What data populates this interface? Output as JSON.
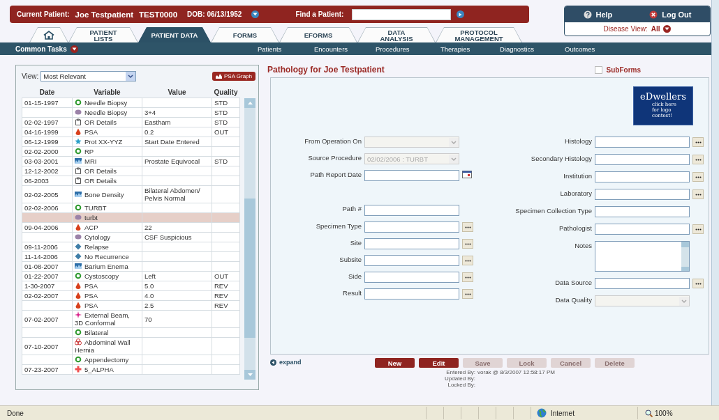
{
  "header": {
    "patient_label": "Current Patient:",
    "patient_name": "Joe Testpatient",
    "patient_id": "TEST0000",
    "dob": "DOB: 06/13/1952",
    "find_label": "Find a Patient:"
  },
  "user_box": {
    "help": "Help",
    "logout": "Log Out",
    "disease_view_label": "Disease View:",
    "disease_view_value": "All"
  },
  "tabs": [
    {
      "kind": "home",
      "selected": false
    },
    {
      "kind": "text",
      "label": "PATIENT\nLISTS",
      "selected": false
    },
    {
      "kind": "text",
      "label": "PATIENT DATA",
      "selected": true
    },
    {
      "kind": "text",
      "label": "FORMS",
      "selected": false
    },
    {
      "kind": "text",
      "label": "EFORMS",
      "selected": false
    },
    {
      "kind": "text",
      "label": "DATA\nANALYSIS",
      "selected": false
    },
    {
      "kind": "text",
      "label": "PROTOCOL\nMANAGEMENT",
      "selected": false
    }
  ],
  "subnav": {
    "common_tasks": "Common Tasks",
    "links": [
      "Patients",
      "Encounters",
      "Procedures",
      "Therapies",
      "Diagnostics",
      "Outcomes"
    ]
  },
  "left_panel": {
    "view_label": "View:",
    "view_value": "Most Relevant",
    "graph_button": "PSA Graph"
  },
  "table": {
    "columns": [
      "Date",
      "Variable",
      "Value",
      "Quality"
    ],
    "rows": [
      {
        "date": "01-15-1997",
        "kind": "ring",
        "variable": "Needle Biopsy",
        "quality": "STD",
        "selected": false
      },
      {
        "kind": "blob",
        "variable": "Needle Biopsy",
        "value": "3+4",
        "quality": "STD",
        "selected": false
      },
      {
        "date": "02-02-1997",
        "kind": "clipboard",
        "variable": "OR Details",
        "value": "Eastham",
        "quality": "STD",
        "selected": false
      },
      {
        "date": "04-16-1999",
        "kind": "drop",
        "variable": "PSA",
        "value": "0.2",
        "quality": "OUT",
        "selected": false
      },
      {
        "date": "06-12-1999",
        "kind": "star",
        "variable": "Prot XX-YYZ",
        "value": "Start Date Entered",
        "selected": false
      },
      {
        "date": "02-02-2000",
        "kind": "ring",
        "variable": "RP",
        "selected": false
      },
      {
        "date": "03-03-2001",
        "kind": "scan",
        "variable": "MRI",
        "value": "Prostate Equivocal",
        "quality": "STD",
        "selected": false
      },
      {
        "date": "12-12-2002",
        "kind": "clipboard",
        "variable": "OR Details",
        "selected": false
      },
      {
        "date": "06-2003",
        "kind": "clipboard",
        "variable": "OR Details",
        "selected": false
      },
      {
        "date": "02-02-2005",
        "kind": "scan",
        "variable": "Bone Density",
        "value": "Bilateral Abdomen/ Pelvis Normal",
        "selected": false
      },
      {
        "date": "02-02-2006",
        "kind": "ring",
        "variable": "TURBT",
        "selected": false
      },
      {
        "kind": "blob",
        "variable": "turbt",
        "selected": true
      },
      {
        "date": "09-04-2006",
        "kind": "drop",
        "variable": "ACP",
        "value": "22",
        "selected": false
      },
      {
        "kind": "blob",
        "variable": "Cytology",
        "value": "CSF Suspicious",
        "selected": false
      },
      {
        "date": "09-11-2006",
        "kind": "diamond",
        "variable": "Relapse",
        "selected": false
      },
      {
        "date": "11-14-2006",
        "kind": "diamond",
        "variable": "No Recurrence",
        "selected": false
      },
      {
        "date": "01-08-2007",
        "kind": "scan",
        "variable": "Barium Enema",
        "selected": false
      },
      {
        "date": "01-22-2007",
        "kind": "ring",
        "variable": "Cystoscopy",
        "value": "Left",
        "quality": "OUT",
        "selected": false
      },
      {
        "date": "1-30-2007",
        "kind": "drop",
        "variable": "PSA",
        "value": "5.0",
        "quality": "REV",
        "selected": false
      },
      {
        "date": "02-02-2007",
        "kind": "drop",
        "variable": "PSA",
        "value": "4.0",
        "quality": "REV",
        "selected": false
      },
      {
        "kind": "drop",
        "variable": "PSA",
        "value": "2.5",
        "quality": "REV",
        "selected": false
      },
      {
        "date": "07-02-2007",
        "kind": "spark",
        "variable": "External Beam, 3D Conformal",
        "value": "70",
        "selected": false
      },
      {
        "kind": "ring",
        "variable": "Bilateral",
        "selected": false
      },
      {
        "date": "07-10-2007",
        "kind": "rings",
        "variable": "Abdominal Wall Hernia",
        "selected": false
      },
      {
        "kind": "ring",
        "variable": "Appendectomy",
        "selected": false
      },
      {
        "date": "07-23-2007",
        "kind": "cross",
        "variable": "5_ALPHA",
        "selected": false
      }
    ]
  },
  "form": {
    "title": "Pathology for Joe Testpatient",
    "subforms": {
      "label": "SubForms",
      "checked": false
    },
    "logo": {
      "title": "eDwellers",
      "caption": "click here for logo contest!"
    },
    "left_fields": [
      {
        "kind": "select",
        "label": "From Operation On",
        "disabled": true
      },
      {
        "kind": "select",
        "label": "Source Procedure",
        "value": "02/02/2006 : TURBT",
        "disabled": true
      },
      {
        "kind": "date",
        "label": "Path Report Date"
      },
      {
        "kind": "text",
        "label": "Path #"
      },
      {
        "kind": "lookup",
        "label": "Specimen Type"
      },
      {
        "kind": "lookup",
        "label": "Site"
      },
      {
        "kind": "lookup",
        "label": "Subsite"
      },
      {
        "kind": "lookup",
        "label": "Side"
      },
      {
        "kind": "lookup",
        "label": "Result"
      }
    ],
    "right_fields": [
      {
        "kind": "lookup",
        "label": "Histology"
      },
      {
        "kind": "lookup",
        "label": "Secondary Histology"
      },
      {
        "kind": "lookup",
        "label": "Institution"
      },
      {
        "kind": "lookup",
        "label": "Laboratory"
      },
      {
        "kind": "text",
        "label": "Specimen Collection Type"
      },
      {
        "kind": "lookup",
        "label": "Pathologist"
      },
      {
        "kind": "textarea",
        "label": "Notes"
      },
      {
        "kind": "lookup",
        "label": "Data Source"
      },
      {
        "kind": "select",
        "label": "Data Quality",
        "disabled": true
      }
    ],
    "expand": "expand",
    "buttons": [
      {
        "label": "New",
        "disabled": false
      },
      {
        "label": "Edit",
        "disabled": false
      },
      {
        "label": "Save",
        "disabled": true
      },
      {
        "label": "Lock",
        "disabled": true
      },
      {
        "label": "Cancel",
        "disabled": true
      },
      {
        "label": "Delete",
        "disabled": true
      }
    ],
    "audit": [
      {
        "label": "Entered By:",
        "value": "vorak @ 8/3/2007 12:58:17 PM"
      },
      {
        "label": "Updated By:"
      },
      {
        "label": "Locked By:"
      }
    ]
  },
  "status_bar": {
    "status": "Done",
    "zone": "Internet",
    "zoom": "100%"
  }
}
